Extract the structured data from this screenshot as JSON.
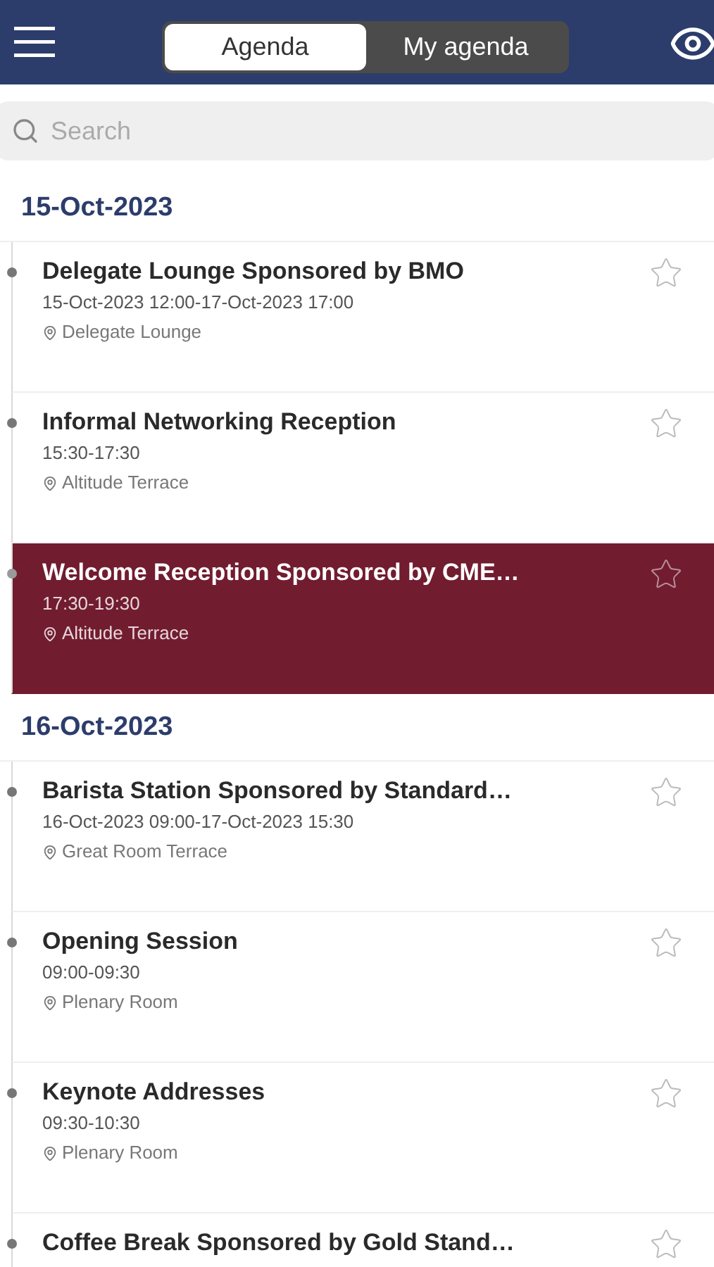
{
  "header": {
    "tabs": [
      {
        "label": "Agenda",
        "selected": true
      },
      {
        "label": "My agenda",
        "selected": false
      }
    ]
  },
  "search": {
    "placeholder": "Search"
  },
  "days": [
    {
      "date": "15-Oct-2023",
      "sessions": [
        {
          "title": "Delegate Lounge Sponsored by BMO",
          "time": "15-Oct-2023 12:00-17-Oct-2023 17:00",
          "location": "Delegate Lounge",
          "selected": false,
          "starred": false
        },
        {
          "title": "Informal Networking Reception",
          "time": "15:30-17:30",
          "location": "Altitude Terrace",
          "selected": false,
          "starred": false
        },
        {
          "title": "Welcome Reception Sponsored by CME…",
          "time": "17:30-19:30",
          "location": "Altitude Terrace",
          "selected": true,
          "starred": false
        }
      ]
    },
    {
      "date": "16-Oct-2023",
      "sessions": [
        {
          "title": "Barista Station Sponsored by Standard…",
          "time": "16-Oct-2023 09:00-17-Oct-2023 15:30",
          "location": "Great Room Terrace",
          "selected": false,
          "starred": false
        },
        {
          "title": "Opening Session",
          "time": "09:00-09:30",
          "location": "Plenary Room",
          "selected": false,
          "starred": false
        },
        {
          "title": "Keynote Addresses",
          "time": "09:30-10:30",
          "location": "Plenary Room",
          "selected": false,
          "starred": false
        },
        {
          "title": "Coffee Break Sponsored by Gold Stand…",
          "selected": false,
          "starred": false
        }
      ]
    }
  ]
}
